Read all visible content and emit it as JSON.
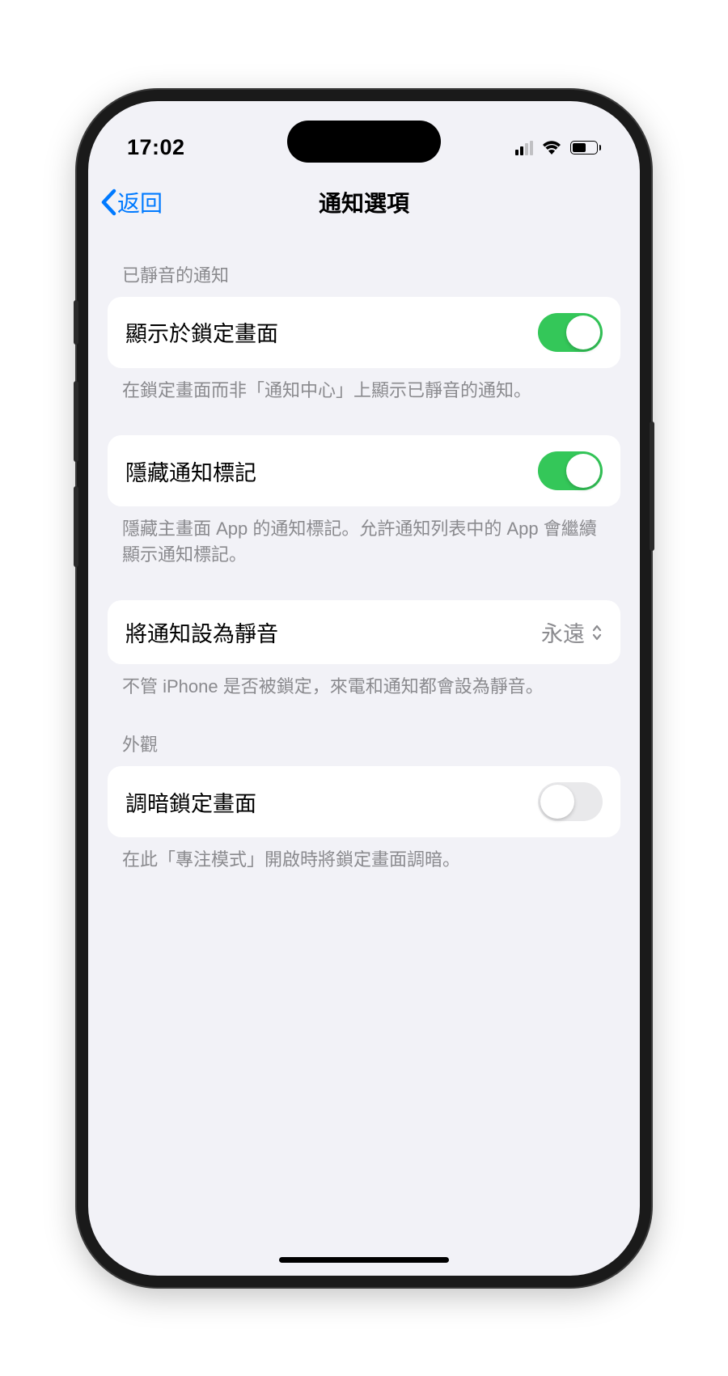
{
  "status": {
    "time": "17:02"
  },
  "nav": {
    "back_label": "返回",
    "title": "通知選項"
  },
  "sections": {
    "muted": {
      "header": "已靜音的通知",
      "show_lock": {
        "label": "顯示於鎖定畫面",
        "on": true,
        "footer": "在鎖定畫面而非「通知中心」上顯示已靜音的通知。"
      },
      "hide_badge": {
        "label": "隱藏通知標記",
        "on": true,
        "footer": "隱藏主畫面 App 的通知標記。允許通知列表中的 App 會繼續顯示通知標記。"
      },
      "mute_notif": {
        "label": "將通知設為靜音",
        "value": "永遠",
        "footer": "不管 iPhone 是否被鎖定，來電和通知都會設為靜音。"
      }
    },
    "appearance": {
      "header": "外觀",
      "dim_lock": {
        "label": "調暗鎖定畫面",
        "on": false,
        "footer": "在此「專注模式」開啟時將鎖定畫面調暗。"
      }
    }
  }
}
